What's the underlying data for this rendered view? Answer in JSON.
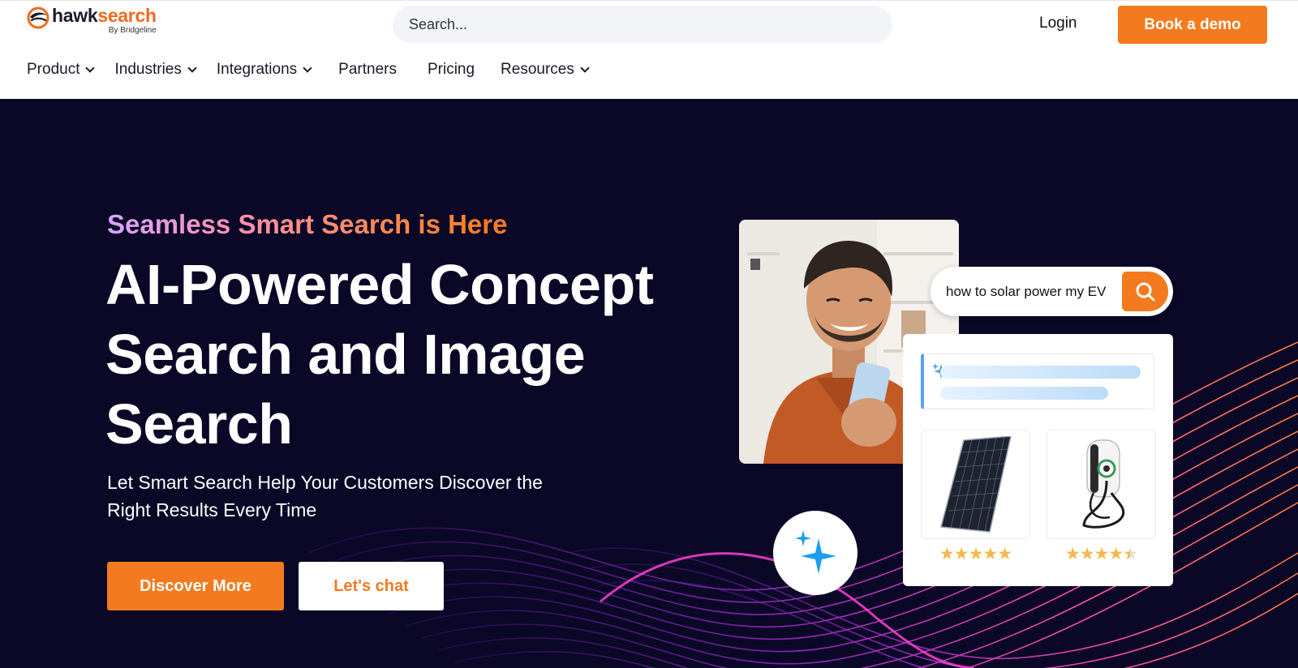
{
  "brand": {
    "word_a": "hawk",
    "word_b": "search",
    "sub": "By Bridgeline",
    "accent": "#f47a1f",
    "dark": "#0a0727"
  },
  "header": {
    "search_placeholder": "Search...",
    "login": "Login",
    "demo_button": "Book a demo"
  },
  "nav": {
    "product": "Product",
    "industries": "Industries",
    "integrations": "Integrations",
    "partners": "Partners",
    "pricing": "Pricing",
    "resources": "Resources"
  },
  "hero": {
    "eyebrow": "Seamless Smart Search is Here",
    "headline": "AI-Powered Concept Search and Image Search",
    "subhead": "Let Smart Search Help Your Customers Discover the Right Results Every Time",
    "primary_cta": "Discover More",
    "secondary_cta": "Let's chat"
  },
  "demo": {
    "query": "how to solar power my EV",
    "product1_rating": 5,
    "product2_rating": 4.5,
    "rating_max": 5
  },
  "icons": {
    "search": "search-icon",
    "sparkle": "sparkle-icon",
    "chevron": "chevron-down-icon"
  }
}
